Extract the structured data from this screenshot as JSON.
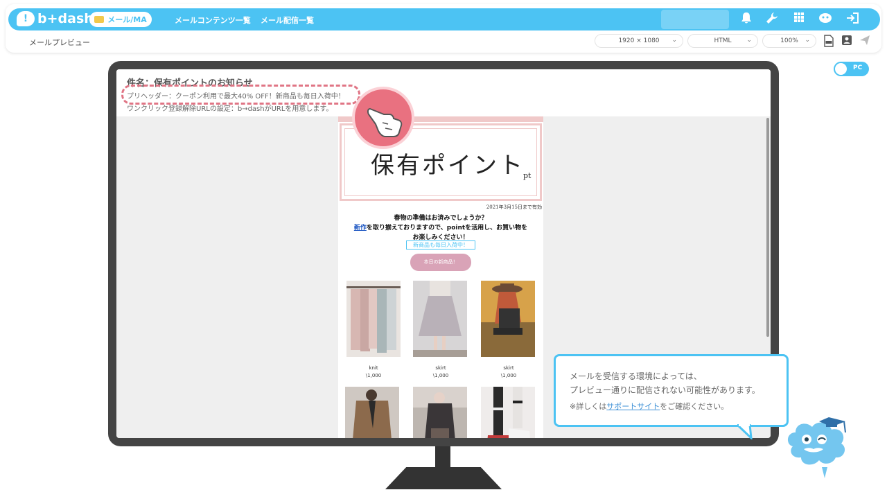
{
  "header": {
    "logo_text": "b+dash",
    "logo_mark": "!",
    "mode_label": "メール/MA",
    "nav": [
      "メールコンテンツ一覧",
      "メール配信一覧"
    ],
    "icons": [
      "bell-icon",
      "wrench-icon",
      "grid-icon",
      "mascot-icon",
      "logout-icon"
    ]
  },
  "subbar": {
    "title": "メールプレビュー",
    "resolution": "1920 × 1080",
    "format": "HTML",
    "zoom": "100%"
  },
  "toggle": {
    "label": "PC"
  },
  "mail": {
    "subject": "件名：保有ポイントのお知らせ",
    "preheader": "プリヘッダー：クーポン利用で最大40% OFF！新商品も毎日入荷中！",
    "unsubscribe": "ワンクリック登録解除URLの設定：b→dashがURLを用意します。"
  },
  "email": {
    "banner_title": "保有ポイント",
    "banner_unit": "pt",
    "valid_until": "2021年3月15日まで有効",
    "msg_line1": "春物の準備はお済みでしょうか？",
    "msg_link": "新作",
    "msg_line2_rest": "を取り揃えておりますので、pointを活用し、お買い物を",
    "msg_line3": "お楽しみください！",
    "new_badge": "新商品も毎日入荷中！",
    "cta": "本日の新商品！",
    "products": [
      {
        "name": "knit",
        "price": "\\1,000",
        "color": "#c9a7a3"
      },
      {
        "name": "skirt",
        "price": "\\1,000",
        "color": "#b9b1b8"
      },
      {
        "name": "skirt",
        "price": "\\1,000",
        "color": "#8a6a3a"
      },
      {
        "name": "",
        "price": "",
        "color": "#8c6a4c"
      },
      {
        "name": "",
        "price": "",
        "color": "#6a5c55"
      },
      {
        "name": "",
        "price": "",
        "color": "#d5d1cf"
      }
    ]
  },
  "tooltip": {
    "line1": "メールを受信する環境によっては、",
    "line2": "プレビュー通りに配信されない可能性があります。",
    "line3_pre": "※詳しくは",
    "line3_link": "サポートサイト",
    "line3_post": "をご確認ください。"
  },
  "colors": {
    "brand": "#4cc3f3",
    "accent_pink": "#e97180",
    "banner_pink": "#f0c9c9",
    "cta_pink": "#d9a3b7",
    "monitor": "#444444"
  }
}
